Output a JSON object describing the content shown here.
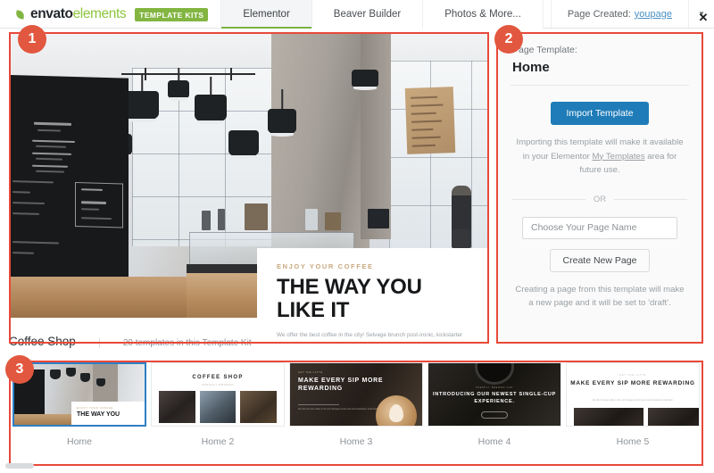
{
  "topbar": {
    "logo": {
      "envato": "envato",
      "elements": "elements",
      "badge": "TEMPLATE KITS"
    },
    "tabs": [
      {
        "label": "Elementor",
        "active": true
      },
      {
        "label": "Beaver Builder",
        "active": false
      },
      {
        "label": "Photos & More...",
        "active": false
      }
    ],
    "page_created_label": "Page Created:",
    "page_created_link": "youpage",
    "caret": "▼"
  },
  "annotations": {
    "badge_1": "1",
    "badge_2": "2",
    "badge_3": "3",
    "color": "#e8493a"
  },
  "preview": {
    "hero": {
      "kicker": "ENJOY YOUR COFFEE",
      "title_line1": "THE WAY YOU",
      "title_line2": "LIKE IT",
      "body": "We offer the best coffee in the city! Selvage brunch post-ironic, kickstarter small batch migas hammock etsy put a bird on it snackwave biodiesel."
    },
    "kit_title": "Coffee Shop",
    "kit_count": "20 templates in this Template Kit"
  },
  "panel": {
    "label": "Page Template:",
    "title": "Home",
    "import_button": "Import Template",
    "note_before_link": "Importing this template will make it available in your Elementor ",
    "note_link": "My Templates",
    "note_after_link": " area for future use.",
    "or": "OR",
    "page_name_placeholder": "Choose Your Page Name",
    "create_button": "Create New Page",
    "create_note": "Creating a page from this template will make a new page and it will be set to 'draft'.",
    "close": "✕",
    "primary_color": "#1f7cb8"
  },
  "thumbnails": [
    {
      "label": "Home",
      "selected": true,
      "kicker": "ENJOY YOUR COFFEE",
      "title": "THE WAY YOU"
    },
    {
      "label": "Home 2",
      "selected": false,
      "heading": "COFFEE SHOP",
      "sub": "FRESHLY BREWED"
    },
    {
      "label": "Home 3",
      "selected": false,
      "kicker": "GET THE LATTE",
      "title": "MAKE EVERY SIP MORE REWARDING",
      "sub": "We offer the best coffee in the city! Selvage brunch post-ironic kickstarter small batch."
    },
    {
      "label": "Home 4",
      "selected": false,
      "kicker": "FRESHLY BREWED CUP",
      "title": "INTRODUCING OUR NEWEST SINGLE-CUP EXPERIENCE."
    },
    {
      "label": "Home 5",
      "selected": false,
      "kicker": "GET THE LATTE",
      "title": "MAKE EVERY SIP MORE REWARDING",
      "sub": "We offer the best coffee in the city! Selvage brunch post-ironic kickstarter small batch."
    }
  ]
}
